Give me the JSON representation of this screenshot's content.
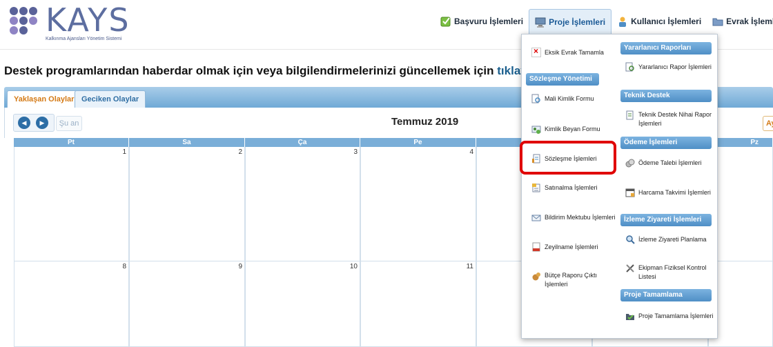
{
  "logo": {
    "text": "KAYS",
    "subtitle": "Kalkınma Ajansları Yönetim Sistemi",
    "dot_colors": [
      "#5a6299",
      "#5a6299",
      "#5a6299",
      "#8f84c4",
      "#5a6299",
      "#8f84c4"
    ]
  },
  "topnav": {
    "items": [
      {
        "label": "Başvuru İşlemleri",
        "icon": "checkbox-icon"
      },
      {
        "label": "Proje İşlemleri",
        "icon": "computer-icon",
        "active": true
      },
      {
        "label": "Kullanıcı İşlemleri",
        "icon": "user-icon"
      },
      {
        "label": "Evrak İşlemleri",
        "icon": "folder-icon"
      }
    ]
  },
  "banner": {
    "text": "Destek programlarından haberdar olmak için veya bilgilendirmelerinizi güncellemek için",
    "link": "tıklay"
  },
  "tabs": [
    "Yaklaşan Olaylar",
    "Geciken Olaylar"
  ],
  "calendar": {
    "today_label": "Şu an",
    "title": "Temmuz 2019",
    "month_btn": "Ay",
    "days": [
      "Pt",
      "Sa",
      "Ça",
      "Pe",
      "",
      "",
      "Pz"
    ],
    "week1": [
      "1",
      "2",
      "3",
      "4"
    ],
    "week2": [
      "8",
      "9",
      "10",
      "11"
    ]
  },
  "dropdown": {
    "left": {
      "eksik_evrak": "Eksik Evrak Tamamla",
      "section_sozlesme": "Sözleşme Yönetimi",
      "items": [
        "Mali Kimlik Formu",
        "Kimlik Beyan Formu",
        "Sözleşme İşlemleri",
        "Satınalma İşlemleri",
        "Bildirim Mektubu İşlemleri",
        "Zeyilname İşlemleri",
        "Bütçe Raporu Çıktı İşlemleri"
      ]
    },
    "right": {
      "sections": [
        {
          "title": "Yararlanıcı Raporları",
          "items": [
            "Yararlanıcı Rapor İşlemleri"
          ]
        },
        {
          "title": "Teknik Destek",
          "items": [
            "Teknik Destek Nihai Rapor İşlemleri"
          ]
        },
        {
          "title": "Ödeme İşlemleri",
          "items": [
            "Ödeme Talebi İşlemleri",
            "Harcama Takvimi İşlemleri"
          ]
        },
        {
          "title": "İzleme Ziyareti İşlemleri",
          "items": [
            "İzleme Ziyareti Planlama",
            "Ekipman Fiziksel Kontrol Listesi"
          ]
        },
        {
          "title": "Proje Tamamlama İşlemleri",
          "items": [
            "Proje Tamamlama İşlemleri"
          ]
        }
      ]
    }
  }
}
